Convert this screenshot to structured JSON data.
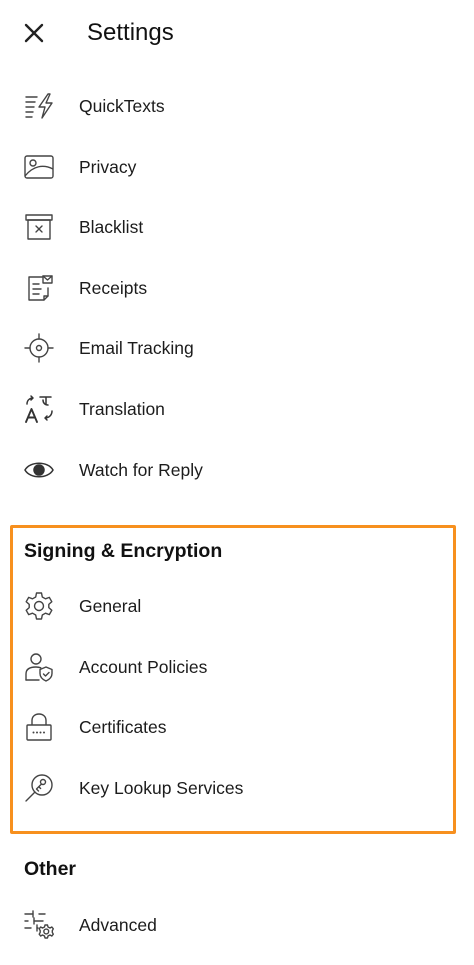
{
  "header": {
    "title": "Settings",
    "close_icon": "close-icon"
  },
  "menu_items": [
    {
      "label": "QuickTexts",
      "icon": "quicktext-icon"
    },
    {
      "label": "Privacy",
      "icon": "image-icon"
    },
    {
      "label": "Blacklist",
      "icon": "archive-x-icon"
    },
    {
      "label": "Receipts",
      "icon": "receipt-icon"
    },
    {
      "label": "Email Tracking",
      "icon": "target-icon"
    },
    {
      "label": "Translation",
      "icon": "translate-icon"
    },
    {
      "label": "Watch for Reply",
      "icon": "eye-icon"
    }
  ],
  "signing_section": {
    "title": "Signing & Encryption",
    "highlight_color": "#f7901e",
    "items": [
      {
        "label": "General",
        "icon": "gear-icon"
      },
      {
        "label": "Account Policies",
        "icon": "user-shield-icon"
      },
      {
        "label": "Certificates",
        "icon": "lock-icon"
      },
      {
        "label": "Key Lookup Services",
        "icon": "key-search-icon"
      }
    ]
  },
  "other_section": {
    "title": "Other",
    "items": [
      {
        "label": "Advanced",
        "icon": "sliders-gear-icon"
      }
    ]
  }
}
